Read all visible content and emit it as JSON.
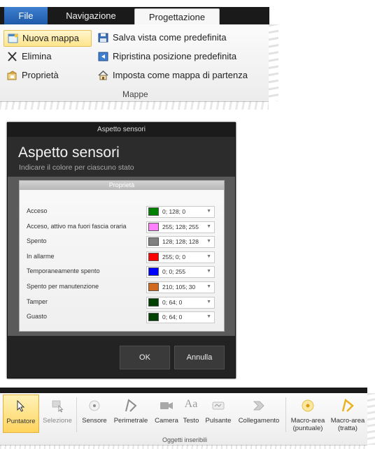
{
  "ribbon_top": {
    "tabs": [
      {
        "label": "File"
      },
      {
        "label": "Navigazione"
      },
      {
        "label": "Progettazione"
      }
    ],
    "buttons": {
      "nuova_mappa": "Nuova mappa",
      "elimina": "Elimina",
      "proprieta": "Proprietà",
      "salva_vista": "Salva vista come predefinita",
      "ripristina": "Ripristina posizione predefinita",
      "imposta_mappa": "Imposta come mappa di partenza"
    },
    "group_label": "Mappe"
  },
  "dialog": {
    "window_title": "Aspetto sensori",
    "heading": "Aspetto sensori",
    "subtitle": "Indicare il colore per ciascuno stato",
    "panel_header": "Proprietà",
    "rows": [
      {
        "label": "Acceso",
        "value": "0; 128; 0",
        "color": "#008000"
      },
      {
        "label": "Acceso, attivo ma fuori fascia oraria",
        "value": "255; 128; 255",
        "color": "#ff80ff"
      },
      {
        "label": "Spento",
        "value": "128; 128; 128",
        "color": "#808080"
      },
      {
        "label": "In allarme",
        "value": "255; 0; 0",
        "color": "#ff0000"
      },
      {
        "label": "Temporaneamente spento",
        "value": "0; 0; 255",
        "color": "#0000ff"
      },
      {
        "label": "Spento per manutenzione",
        "value": "210; 105; 30",
        "color": "#d2691e"
      },
      {
        "label": "Tamper",
        "value": "0; 64; 0",
        "color": "#004000"
      },
      {
        "label": "Guasto",
        "value": "0; 64; 0",
        "color": "#004000"
      }
    ],
    "ok": "OK",
    "cancel": "Annulla"
  },
  "ribbon_bottom": {
    "buttons": {
      "puntatore": "Puntatore",
      "selezione": "Selezione",
      "sensore": "Sensore",
      "perimetrale": "Perimetrale",
      "camera": "Camera",
      "testo": "Testo",
      "pulsante": "Pulsante",
      "collegamento": "Collegamento",
      "macro_puntuale_1": "Macro-area",
      "macro_puntuale_2": "(puntuale)",
      "macro_tratta_1": "Macro-area",
      "macro_tratta_2": "(tratta)"
    },
    "group_label": "Oggetti inseribili",
    "text_icon_glyph": "Aa",
    "accent_color": "#ffd45e"
  }
}
